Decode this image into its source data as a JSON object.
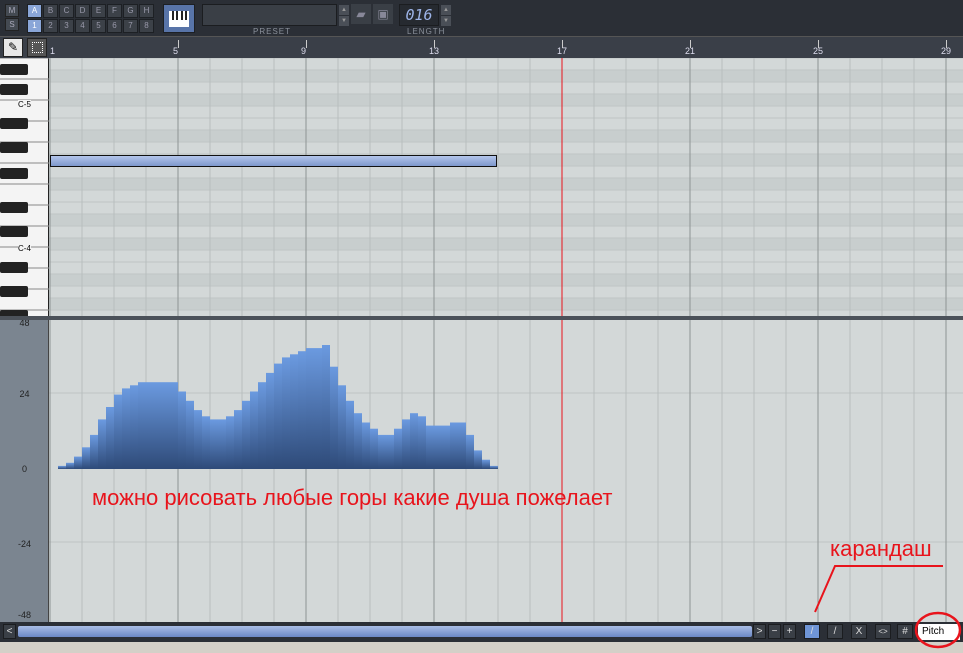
{
  "toolbar": {
    "mute": "M",
    "solo": "S",
    "patterns": [
      "A",
      "B",
      "C",
      "D",
      "E",
      "F",
      "G",
      "H"
    ],
    "numbers": [
      "1",
      "2",
      "3",
      "4",
      "5",
      "6",
      "7",
      "8"
    ],
    "preset_label": "PRESET",
    "preset_value": "",
    "length_label": "LENGTH",
    "length_value": "016"
  },
  "ruler": {
    "bars": [
      "1",
      "5",
      "9",
      "13",
      "17",
      "21",
      "25",
      "29"
    ]
  },
  "piano": {
    "labels": [
      "C-5",
      "C-4"
    ]
  },
  "lane": {
    "y_labels": [
      "48",
      "24",
      "0",
      "-24",
      "-48"
    ],
    "mode": "Pitch"
  },
  "bottom": {
    "left": "<",
    "right": ">",
    "minus": "−",
    "plus": "+",
    "pencil": "/",
    "line": "/",
    "clear": "X",
    "mirror": "<>",
    "grid": "#"
  },
  "annotations": {
    "main": "можно рисовать любые горы какие душа пожелает",
    "pencil": "карандаш"
  },
  "colors": {
    "accent": "#5a8ad4",
    "playhead": "#e8141c"
  },
  "chart_data": {
    "type": "bar",
    "title": "Pitch automation",
    "ylim": [
      -48,
      48
    ],
    "step_beats": 0.25,
    "values": [
      0,
      1,
      2,
      4,
      7,
      11,
      16,
      20,
      24,
      26,
      27,
      28,
      28,
      28,
      28,
      28,
      25,
      22,
      19,
      17,
      16,
      16,
      17,
      19,
      22,
      25,
      28,
      31,
      34,
      36,
      37,
      38,
      39,
      39,
      40,
      33,
      27,
      22,
      18,
      15,
      13,
      11,
      11,
      13,
      16,
      18,
      17,
      14,
      14,
      14,
      15,
      15,
      11,
      6,
      3,
      1
    ]
  }
}
